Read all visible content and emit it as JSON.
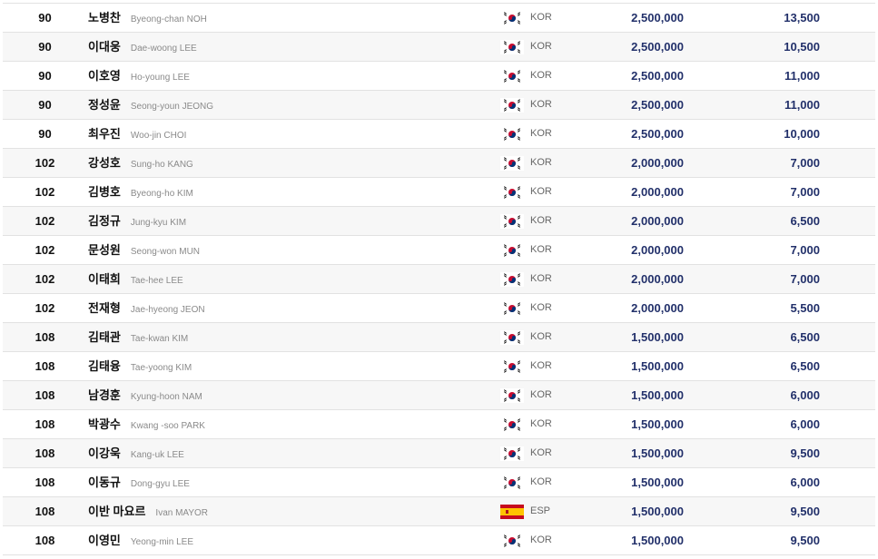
{
  "colors": {
    "amount_text": "#22306a",
    "row_alt": "#f7f7f7",
    "border": "#e2e2e2"
  },
  "rows": [
    {
      "rank": "90",
      "name": "노병찬",
      "english": "Byeong-chan NOH",
      "flag": "kor-flag-icon",
      "nat": "KOR",
      "prize": "2,500,000",
      "points": "13,500"
    },
    {
      "rank": "90",
      "name": "이대웅",
      "english": "Dae-woong LEE",
      "flag": "kor-flag-icon",
      "nat": "KOR",
      "prize": "2,500,000",
      "points": "10,500"
    },
    {
      "rank": "90",
      "name": "이호영",
      "english": "Ho-young LEE",
      "flag": "kor-flag-icon",
      "nat": "KOR",
      "prize": "2,500,000",
      "points": "11,000"
    },
    {
      "rank": "90",
      "name": "정성윤",
      "english": "Seong-youn JEONG",
      "flag": "kor-flag-icon",
      "nat": "KOR",
      "prize": "2,500,000",
      "points": "11,000"
    },
    {
      "rank": "90",
      "name": "최우진",
      "english": "Woo-jin CHOI",
      "flag": "kor-flag-icon",
      "nat": "KOR",
      "prize": "2,500,000",
      "points": "10,000"
    },
    {
      "rank": "102",
      "name": "강성호",
      "english": "Sung-ho KANG",
      "flag": "kor-flag-icon",
      "nat": "KOR",
      "prize": "2,000,000",
      "points": "7,000"
    },
    {
      "rank": "102",
      "name": "김병호",
      "english": "Byeong-ho KIM",
      "flag": "kor-flag-icon",
      "nat": "KOR",
      "prize": "2,000,000",
      "points": "7,000"
    },
    {
      "rank": "102",
      "name": "김정규",
      "english": "Jung-kyu KIM",
      "flag": "kor-flag-icon",
      "nat": "KOR",
      "prize": "2,000,000",
      "points": "6,500"
    },
    {
      "rank": "102",
      "name": "문성원",
      "english": "Seong-won MUN",
      "flag": "kor-flag-icon",
      "nat": "KOR",
      "prize": "2,000,000",
      "points": "7,000"
    },
    {
      "rank": "102",
      "name": "이태희",
      "english": "Tae-hee LEE",
      "flag": "kor-flag-icon",
      "nat": "KOR",
      "prize": "2,000,000",
      "points": "7,000"
    },
    {
      "rank": "102",
      "name": "전재형",
      "english": "Jae-hyeong JEON",
      "flag": "kor-flag-icon",
      "nat": "KOR",
      "prize": "2,000,000",
      "points": "5,500"
    },
    {
      "rank": "108",
      "name": "김태관",
      "english": "Tae-kwan KIM",
      "flag": "kor-flag-icon",
      "nat": "KOR",
      "prize": "1,500,000",
      "points": "6,500"
    },
    {
      "rank": "108",
      "name": "김태융",
      "english": "Tae-yoong KIM",
      "flag": "kor-flag-icon",
      "nat": "KOR",
      "prize": "1,500,000",
      "points": "6,500"
    },
    {
      "rank": "108",
      "name": "남경훈",
      "english": "Kyung-hoon NAM",
      "flag": "kor-flag-icon",
      "nat": "KOR",
      "prize": "1,500,000",
      "points": "6,000"
    },
    {
      "rank": "108",
      "name": "박광수",
      "english": "Kwang -soo PARK",
      "flag": "kor-flag-icon",
      "nat": "KOR",
      "prize": "1,500,000",
      "points": "6,000"
    },
    {
      "rank": "108",
      "name": "이강욱",
      "english": "Kang-uk LEE",
      "flag": "kor-flag-icon",
      "nat": "KOR",
      "prize": "1,500,000",
      "points": "9,500"
    },
    {
      "rank": "108",
      "name": "이동규",
      "english": "Dong-gyu LEE",
      "flag": "kor-flag-icon",
      "nat": "KOR",
      "prize": "1,500,000",
      "points": "6,000"
    },
    {
      "rank": "108",
      "name": "이반 마요르",
      "english": "Ivan MAYOR",
      "flag": "esp-flag-icon",
      "nat": "ESP",
      "prize": "1,500,000",
      "points": "9,500"
    },
    {
      "rank": "108",
      "name": "이영민",
      "english": "Yeong-min LEE",
      "flag": "kor-flag-icon",
      "nat": "KOR",
      "prize": "1,500,000",
      "points": "9,500"
    }
  ]
}
